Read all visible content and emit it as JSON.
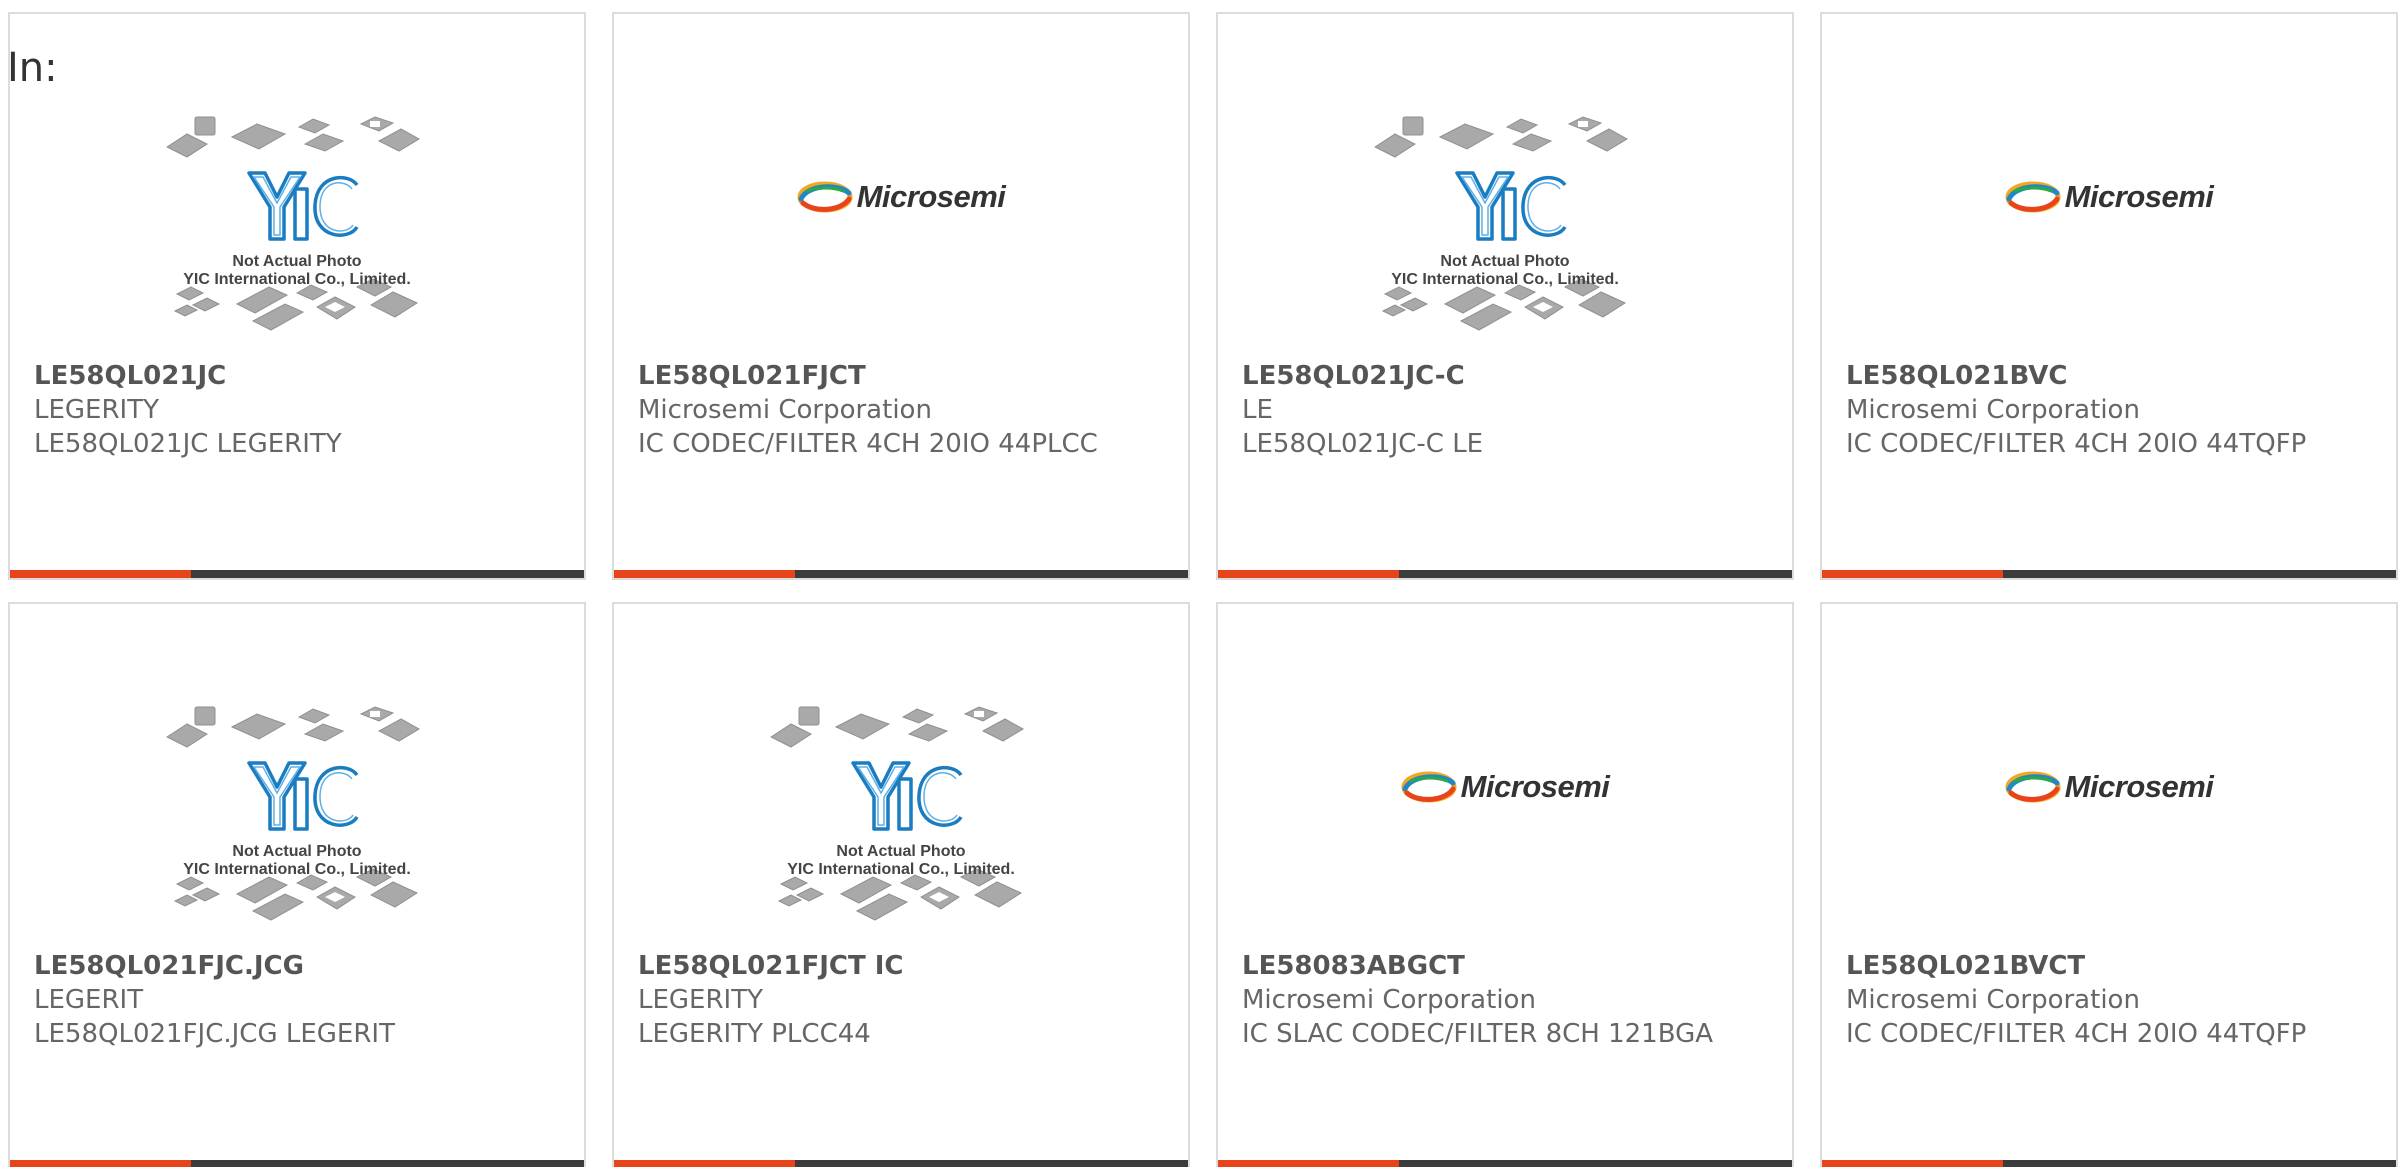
{
  "filter_label": "In:",
  "image_captions": {
    "yic_line1": "Not Actual Photo",
    "yic_line2": "YIC International Co., Limited.",
    "microsemi_logo": "Microsemi"
  },
  "colors": {
    "accent": "#e8441c",
    "bar": "#3c3c3c",
    "card_border": "#dcdcdc",
    "text": "#666666",
    "yic_blue": "#1a7cc1"
  },
  "products": [
    {
      "part_number": "LE58QL021JC",
      "manufacturer": "LEGERITY",
      "description": "LE58QL021JC LEGERITY",
      "image": "yic-placeholder"
    },
    {
      "part_number": "LE58QL021FJCT",
      "manufacturer": "Microsemi Corporation",
      "description": "IC CODEC/FILTER 4CH 20IO 44PLCC",
      "image": "microsemi-logo"
    },
    {
      "part_number": "LE58QL021JC-C",
      "manufacturer": "LE",
      "description": "LE58QL021JC-C LE",
      "image": "yic-placeholder"
    },
    {
      "part_number": "LE58QL021BVC",
      "manufacturer": "Microsemi Corporation",
      "description": "IC CODEC/FILTER 4CH 20IO 44TQFP",
      "image": "microsemi-logo"
    },
    {
      "part_number": "LE58QL021FJC.JCG",
      "manufacturer": "LEGERIT",
      "description": "LE58QL021FJC.JCG LEGERIT",
      "image": "yic-placeholder"
    },
    {
      "part_number": "LE58QL021FJCT IC",
      "manufacturer": "LEGERITY",
      "description": "LEGERITY PLCC44",
      "image": "yic-placeholder"
    },
    {
      "part_number": "LE58083ABGCT",
      "manufacturer": "Microsemi Corporation",
      "description": "IC SLAC CODEC/FILTER 8CH 121BGA",
      "image": "microsemi-logo"
    },
    {
      "part_number": "LE58QL021BVCT",
      "manufacturer": "Microsemi Corporation",
      "description": "IC CODEC/FILTER 4CH 20IO 44TQFP",
      "image": "microsemi-logo"
    }
  ]
}
